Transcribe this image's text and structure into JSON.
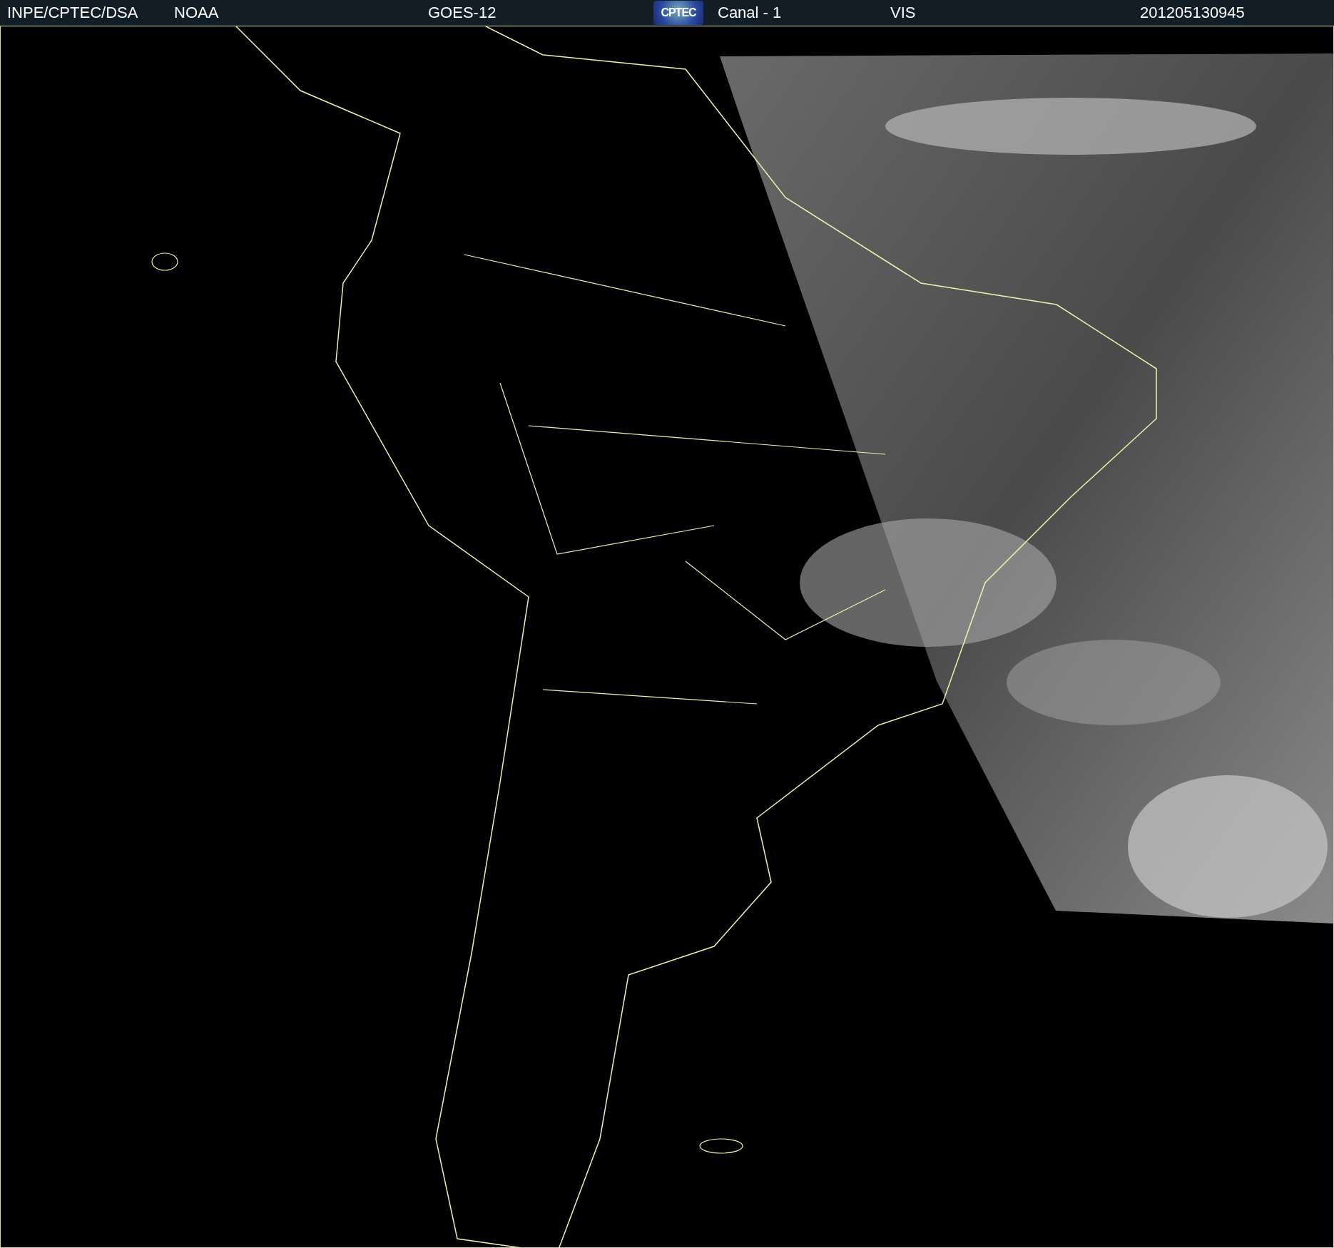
{
  "header": {
    "items": [
      {
        "kind": "text",
        "text": "INPE/CPTEC/DSA"
      },
      {
        "kind": "text",
        "text": "NOAA"
      },
      {
        "kind": "text",
        "text": "GOES-12"
      },
      {
        "kind": "logo",
        "text": "CPTEC"
      },
      {
        "kind": "text",
        "text": "Canal - 1"
      },
      {
        "kind": "text",
        "text": "VIS"
      },
      {
        "kind": "text",
        "text": "201205130945"
      }
    ]
  }
}
